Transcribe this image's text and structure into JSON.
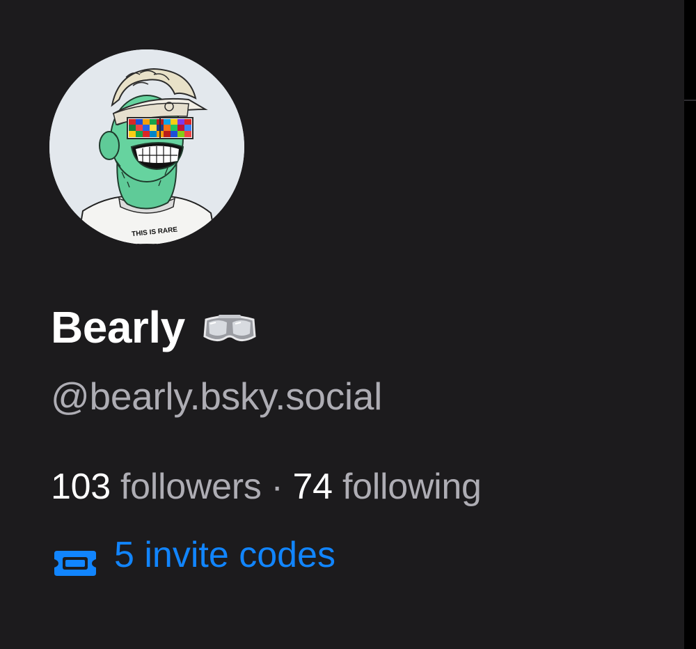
{
  "profile": {
    "display_name": "Bearly",
    "name_badge_icon": "goggles-icon",
    "handle": "@bearly.bsky.social",
    "avatar": {
      "icon": "avatar-image",
      "shirt_text": "THIS IS RARE"
    }
  },
  "stats": {
    "followers_count": "103",
    "followers_label": "followers",
    "separator": "·",
    "following_count": "74",
    "following_label": "following"
  },
  "invites": {
    "icon": "ticket-icon",
    "label": "5 invite codes"
  },
  "colors": {
    "background": "#1c1b1d",
    "text_primary": "#ffffff",
    "text_secondary": "#aeadb4",
    "link_accent": "#1185fe"
  }
}
